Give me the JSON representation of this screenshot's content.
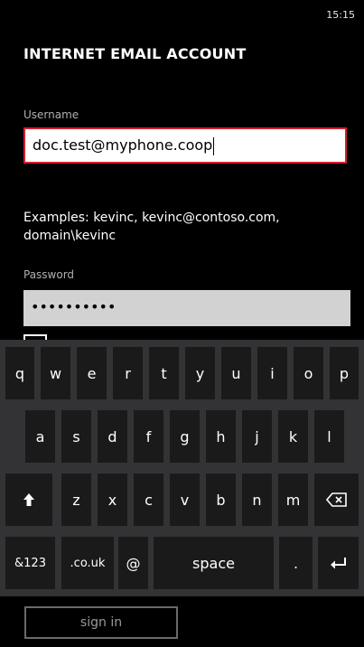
{
  "status_bar": {
    "time": "15:15"
  },
  "page": {
    "title": "INTERNET EMAIL ACCOUNT"
  },
  "username": {
    "label": "Username",
    "value": "doc.test@myphone.coop"
  },
  "examples": {
    "text": "Examples: kevinc, kevinc@contoso.com, domain\\kevinc"
  },
  "password": {
    "label": "Password",
    "masked_value": "••••••••••"
  },
  "keyboard": {
    "row1": [
      "q",
      "w",
      "e",
      "r",
      "t",
      "y",
      "u",
      "i",
      "o",
      "p"
    ],
    "row2": [
      "a",
      "s",
      "d",
      "f",
      "g",
      "h",
      "j",
      "k",
      "l"
    ],
    "row3": [
      "z",
      "x",
      "c",
      "v",
      "b",
      "n",
      "m"
    ],
    "symbols_label": "&123",
    "domain_label": ".co.uk",
    "at_label": "@",
    "space_label": "space",
    "period_label": ".",
    "shift_icon": "shift-arrow-icon",
    "backspace_icon": "backspace-icon",
    "enter_icon": "enter-icon"
  },
  "actions": {
    "sign_in_label": "sign in"
  },
  "colors": {
    "accent_border": "#d22030",
    "background": "#000000",
    "key": "#1a1a1a",
    "keyboard_bg": "#333335"
  }
}
